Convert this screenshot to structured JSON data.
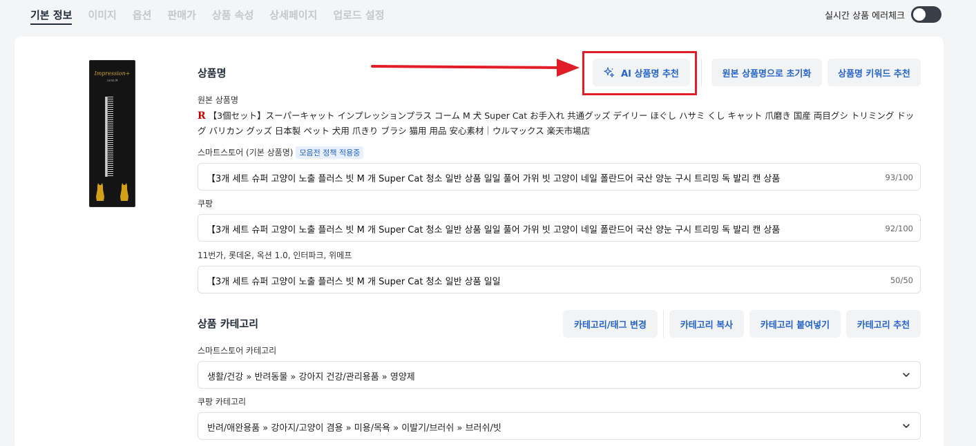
{
  "tabs": [
    {
      "label": "기본 정보",
      "active": true
    },
    {
      "label": "이미지",
      "active": false
    },
    {
      "label": "옵션",
      "active": false
    },
    {
      "label": "판매가",
      "active": false
    },
    {
      "label": "상품 속성",
      "active": false
    },
    {
      "label": "상세페이지",
      "active": false
    },
    {
      "label": "업로드 설정",
      "active": false
    }
  ],
  "realtime_check": {
    "label": "실시간 상품 에러체크",
    "enabled": true
  },
  "product_image": {
    "brand": "Impression+",
    "sub": "comb M"
  },
  "product_name": {
    "title": "상품명",
    "buttons": {
      "ai_recommend": "AI 상품명 추천",
      "reset_original": "원본 상품명으로 초기화",
      "keyword_recommend": "상품명 키워드 추천"
    },
    "original_label": "원본 상품명",
    "original_icon": "R",
    "original_value": "【3個セット】スーパーキャット インプレッションプラス コーム M 犬 Super Cat お手入れ 共通グッズ デイリー ほぐし ハサミ くし キャット 爪磨き 国産 両目グシ トリミング ドッグ バリカン グッズ 日本製 ペット 犬用 爪きり ブラシ 猫用 用品 安心素材｜ウルマックス 楽天市場店",
    "fields": [
      {
        "label": "스마트스토어 (기본 상품명)",
        "badge": "모음전 정책 적용중",
        "value": "【3개 세트  슈퍼 고양이 노출 플러스 빗 M 개 Super Cat 청소 일반 상품 일일 풀어 가위 빗 고양이 네일 폴란드어 국산 양눈 구시 트리밍 독 발리 캔 상품",
        "count": "93/100"
      },
      {
        "label": "쿠팡",
        "value": "【3개 세트  슈퍼 고양이 노출 플러스 빗 M 개 Super Cat 청소 일반 상품 일일 풀어 가위 빗 고양이 네일 폴란드어 국산 양눈 구시 트리밍 독 발리 캔 상품",
        "count": "92/100"
      },
      {
        "label": "11번가, 롯데온, 옥션 1.0, 인터파크, 위메프",
        "value": "【3개 세트  슈퍼 고양이 노출 플러스 빗 M 개 Super Cat 청소 일반 상품 일일",
        "count": "50/50"
      }
    ]
  },
  "category": {
    "title": "상품 카테고리",
    "buttons": {
      "change": "카테고리/태그 변경",
      "copy": "카테고리 복사",
      "paste": "카테고리 붙여넣기",
      "recommend": "카테고리 추천"
    },
    "fields": [
      {
        "label": "스마트스토어 카테고리",
        "value": "생활/건강 » 반려동물 » 강아지 건강/관리용품 » 영양제"
      },
      {
        "label": "쿠팡 카테고리",
        "value": "반려/애완용품 » 강아지/고양이 겸용 » 미용/목욕 » 이발기/브러쉬 » 브러쉬/빗"
      }
    ]
  },
  "colors": {
    "accent": "#2563c9",
    "annotation": "#e11d27",
    "active_tab": "#1f2937"
  }
}
